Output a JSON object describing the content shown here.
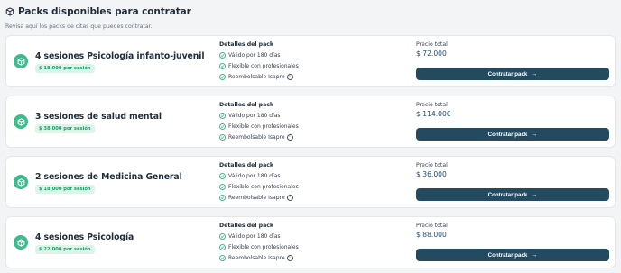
{
  "header": {
    "title": "Packs disponibles para contratar",
    "subtitle": "Revisa aquí los packs de citas que puedes contratar.",
    "icon": "box-icon"
  },
  "colors": {
    "accent": "#3dbb8a",
    "button": "#234a5f",
    "badge_bg": "#dcf5e9",
    "badge_text": "#1f9d6a"
  },
  "details_title": "Detalles del pack",
  "total_label": "Precio total",
  "button_label": "Contratar pack",
  "packs": [
    {
      "name": "4 sesiones Psicología infanto-juvenil",
      "session_price": "$ 18.000 por sesión",
      "features": [
        "Válido por 180 días",
        "Flexible con profesionales",
        "Reembolsable Isapre"
      ],
      "total": "$ 72.000"
    },
    {
      "name": "3 sesiones de salud mental",
      "session_price": "$ 38.000 por sesión",
      "features": [
        "Válido por 180 días",
        "Flexible con profesionales",
        "Reembolsable Isapre"
      ],
      "total": "$ 114.000"
    },
    {
      "name": "2 sesiones de Medicina General",
      "session_price": "$ 18.000 por sesión",
      "features": [
        "Válido por 180 días",
        "Flexible con profesionales",
        "Reembolsable Isapre"
      ],
      "total": "$ 36.000"
    },
    {
      "name": "4 sesiones Psicología",
      "session_price": "$ 22.000 por sesión",
      "features": [
        "Válido por 180 días",
        "Flexible con profesionales",
        "Reembolsable Isapre"
      ],
      "total": "$ 88.000"
    }
  ]
}
